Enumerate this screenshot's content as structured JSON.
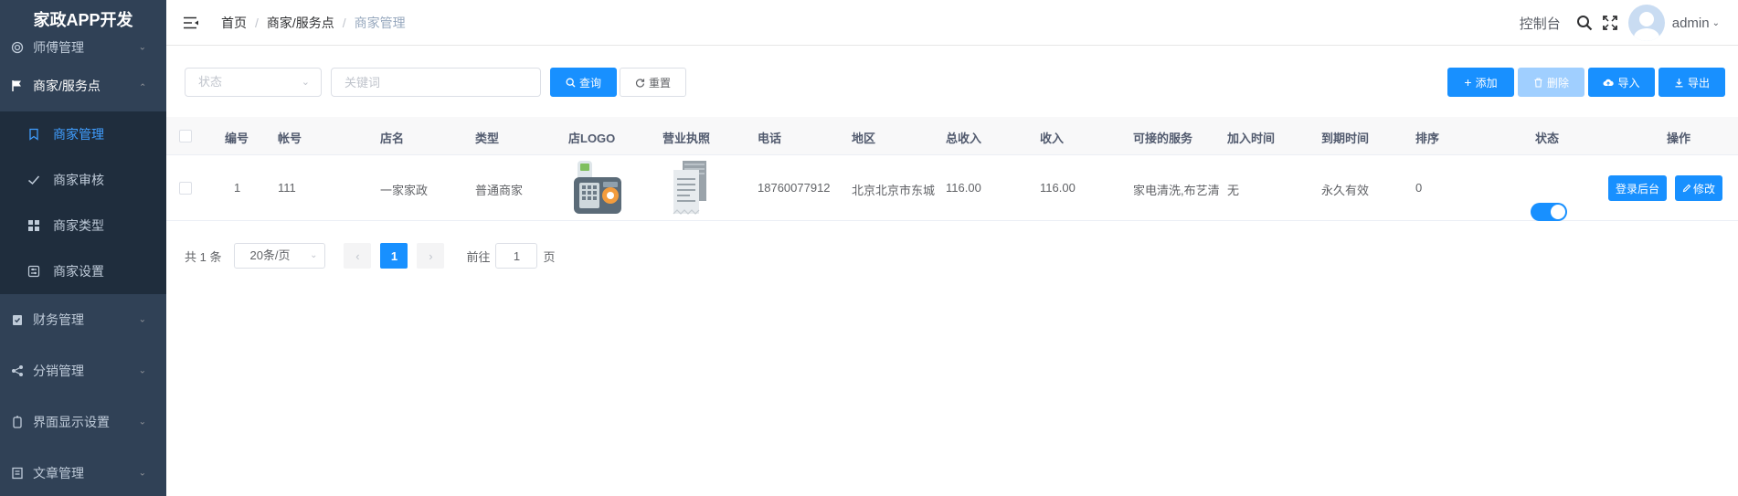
{
  "app_title": "家政APP开发",
  "sidebar": {
    "items": [
      {
        "label": "师傅管理",
        "icon": "circle-ring-icon"
      },
      {
        "label": "商家/服务点",
        "icon": "flag-icon",
        "expanded": true,
        "children": [
          {
            "label": "商家管理",
            "icon": "bookmark-icon",
            "active": true
          },
          {
            "label": "商家审核",
            "icon": "check-icon"
          },
          {
            "label": "商家类型",
            "icon": "grid-icon"
          },
          {
            "label": "商家设置",
            "icon": "settings-panel-icon"
          }
        ]
      },
      {
        "label": "财务管理",
        "icon": "clipboard-check-icon"
      },
      {
        "label": "分销管理",
        "icon": "share-icon"
      },
      {
        "label": "界面显示设置",
        "icon": "device-icon"
      },
      {
        "label": "文章管理",
        "icon": "document-icon"
      }
    ]
  },
  "header": {
    "breadcrumb": [
      "首页",
      "商家/服务点",
      "商家管理"
    ],
    "dashboard": "控制台",
    "username": "admin"
  },
  "toolbar": {
    "status_placeholder": "状态",
    "keyword_placeholder": "关键词",
    "search_label": "查询",
    "reset_label": "重置",
    "add_label": "添加",
    "delete_label": "删除",
    "import_label": "导入",
    "export_label": "导出"
  },
  "table": {
    "headers": [
      "编号",
      "帐号",
      "店名",
      "类型",
      "店LOGO",
      "营业执照",
      "电话",
      "地区",
      "总收入",
      "收入",
      "可接的服务",
      "加入时间",
      "到期时间",
      "排序",
      "状态",
      "操作"
    ],
    "rows": [
      {
        "id": "1",
        "account": "111",
        "shop_name": "一家家政",
        "type": "普通商家",
        "phone": "18760077912",
        "region": "北京北京市东城",
        "total_income": "116.00",
        "income": "116.00",
        "services": "家电清洗,布艺清",
        "join_time": "无",
        "expire_time": "永久有效",
        "sort": "0",
        "status_on": true,
        "login_label": "登录后台",
        "edit_label": "修改"
      }
    ]
  },
  "pagination": {
    "total_text": "共 1 条",
    "page_size": "20条/页",
    "current_page": "1",
    "goto_label": "前往",
    "goto_value": "1",
    "page_suffix": "页"
  },
  "colors": {
    "sidebar_bg": "#304156",
    "submenu_bg": "#1f2d3d",
    "primary": "#1890ff",
    "active_text": "#409eff"
  }
}
